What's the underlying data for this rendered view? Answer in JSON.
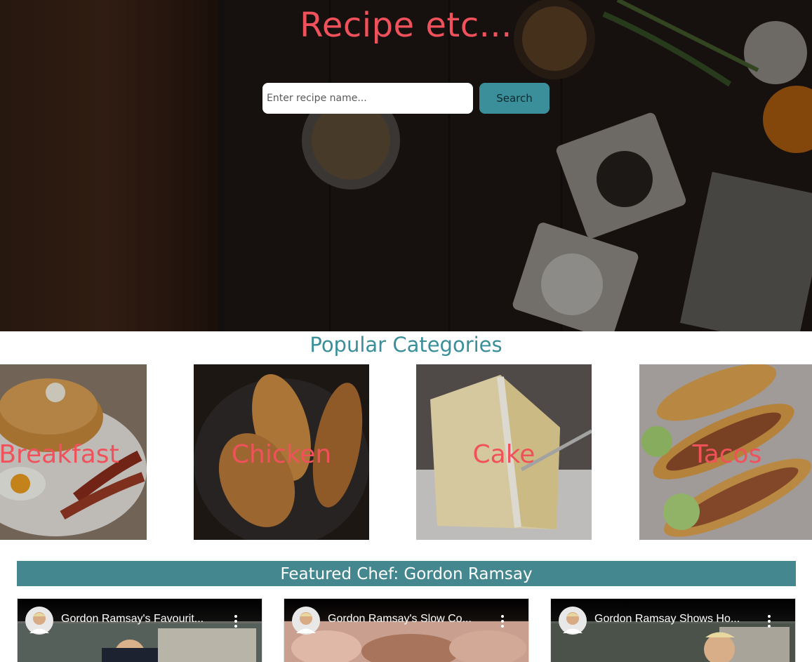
{
  "hero": {
    "title": "Recipe etc...",
    "search": {
      "placeholder": "Enter recipe name...",
      "value": "",
      "button_label": "Search"
    }
  },
  "categories": {
    "heading": "Popular Categories",
    "items": [
      {
        "label": "Breakfast",
        "image": "pancakes-eggs-bacon"
      },
      {
        "label": "Chicken",
        "image": "grilled-chicken-pan"
      },
      {
        "label": "Cake",
        "image": "layer-cake-slice"
      },
      {
        "label": "Tacos",
        "image": "tacos-platter"
      }
    ]
  },
  "featured": {
    "banner": "Featured Chef: Gordon Ramsay",
    "videos": [
      {
        "title": "Gordon Ramsay's Favourite Simple Recipes",
        "display_title": "Gordon Ramsay's Favourit...",
        "avatar_icon": "chef-avatar-icon",
        "menu_icon": "more-vert-icon"
      },
      {
        "title": "Gordon Ramsay's Slow Cooked Recipes",
        "display_title": "Gordon Ramsay's Slow Co...",
        "avatar_icon": "chef-avatar-icon",
        "menu_icon": "more-vert-icon"
      },
      {
        "title": "Gordon Ramsay Shows How",
        "display_title": "Gordon Ramsay Shows Ho...",
        "avatar_icon": "chef-avatar-icon",
        "menu_icon": "more-vert-icon"
      }
    ]
  },
  "colors": {
    "accent_red": "#f0515a",
    "teal": "#3a8f9a",
    "banner_teal": "#44878e"
  }
}
